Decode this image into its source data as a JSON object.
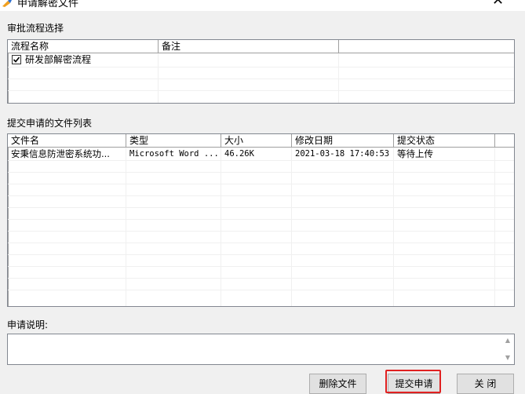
{
  "window": {
    "title": "申请解密文件",
    "close_glyph": "✕"
  },
  "approval": {
    "section_label": "审批流程选择",
    "columns": [
      "流程名称",
      "备注",
      ""
    ],
    "rows": [
      {
        "checked": true,
        "name": "研发部解密流程",
        "note": ""
      }
    ]
  },
  "files": {
    "section_label": "提交申请的文件列表",
    "columns": [
      "文件名",
      "类型",
      "大小",
      "修改日期",
      "提交状态"
    ],
    "rows": [
      {
        "name": "安秉信息防泄密系统功...",
        "type": "Microsoft Word ...",
        "size": "46.26K",
        "modified": "2021-03-18 17:40:53",
        "status": "等待上传"
      }
    ]
  },
  "remark": {
    "label": "申请说明:",
    "value": ""
  },
  "buttons": {
    "delete": "删除文件",
    "submit": "提交申请",
    "close": "关 闭"
  },
  "colors": {
    "highlight": "#e02020"
  }
}
